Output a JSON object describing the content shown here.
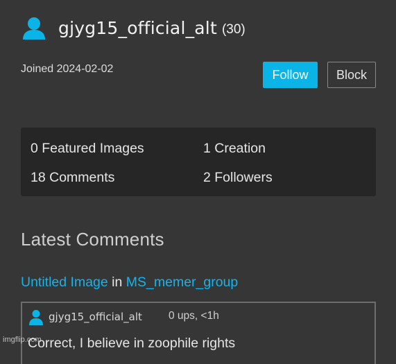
{
  "profile": {
    "username": "gjyg15_official_alt",
    "points": "(30)",
    "joined": "Joined 2024-02-02"
  },
  "actions": {
    "follow_label": "Follow",
    "block_label": "Block"
  },
  "stats": {
    "featured": "0 Featured Images",
    "creations": "1 Creation",
    "comments": "18 Comments",
    "followers": "2 Followers"
  },
  "latest_comments": {
    "title": "Latest Comments",
    "items": [
      {
        "image_title": "Untitled Image",
        "in_word": "in",
        "stream": "MS_memer_group",
        "author": "gjyg15_official_alt",
        "meta": "0 ups, <1h",
        "text": "Correct, I believe in zoophile rights"
      }
    ]
  },
  "watermark": "imgflip.com",
  "colors": {
    "background": "#363636",
    "panel": "#262626",
    "accent": "#0ab4e6",
    "link": "#14b4ec"
  },
  "icons": {
    "user": "user-icon"
  }
}
